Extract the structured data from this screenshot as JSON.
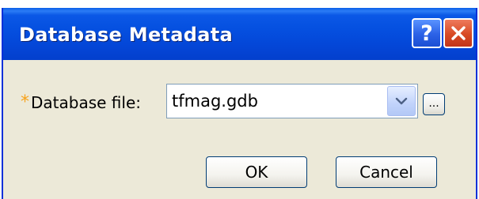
{
  "window": {
    "title": "Database Metadata"
  },
  "titlebar_buttons": {
    "help_glyph": "?",
    "help_icon": "question-mark",
    "close_icon": "x-close"
  },
  "form": {
    "required_marker": "*",
    "database_file_label": "Database file:",
    "database_file_value": "tfmag.gdb",
    "browse_label": "..."
  },
  "buttons": {
    "ok_label": "OK",
    "cancel_label": "Cancel"
  },
  "colors": {
    "titlebar": "#0550e0",
    "required_marker": "#f7a21a",
    "close_button": "#d84a24",
    "window_face": "#ece9d8"
  }
}
